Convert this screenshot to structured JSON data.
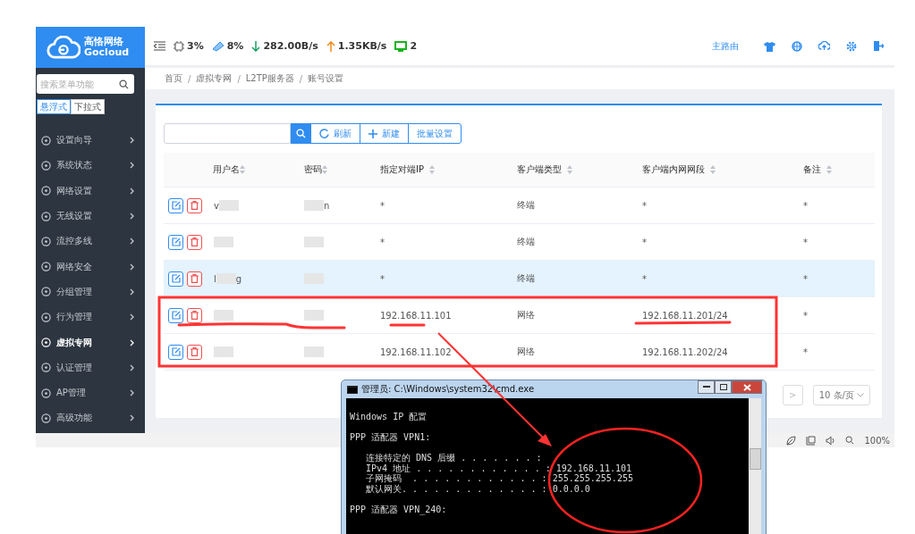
{
  "logo": {
    "name": "高恪网络",
    "brand": "Gocloud"
  },
  "stats": [
    {
      "kind": "cpu",
      "value": "3%"
    },
    {
      "kind": "memory",
      "value": "8%"
    },
    {
      "kind": "down",
      "value": "282.00B/s"
    },
    {
      "kind": "up",
      "value": "1.35KB/s"
    },
    {
      "kind": "devices",
      "value": "2"
    }
  ],
  "header_link": "主路由",
  "breadcrumb": [
    "首页",
    "虚拟专网",
    "L2TP服务器",
    "账号设置"
  ],
  "breadcrumb_separator": "/",
  "sidebar": {
    "search_placeholder": "搜索菜单功能",
    "modes": [
      {
        "label": "悬浮式",
        "selected": true
      },
      {
        "label": "下拉式",
        "selected": false
      }
    ],
    "items": [
      {
        "label": "设置向导",
        "selected": false
      },
      {
        "label": "系统状态",
        "selected": false
      },
      {
        "label": "网络设置",
        "selected": false
      },
      {
        "label": "无线设置",
        "selected": false
      },
      {
        "label": "流控多线",
        "selected": false
      },
      {
        "label": "网络安全",
        "selected": false
      },
      {
        "label": "分组管理",
        "selected": false
      },
      {
        "label": "行为管理",
        "selected": false
      },
      {
        "label": "虚拟专网",
        "selected": true
      },
      {
        "label": "认证管理",
        "selected": false
      },
      {
        "label": "AP管理",
        "selected": false
      },
      {
        "label": "高级功能",
        "selected": false
      }
    ]
  },
  "toolbar": {
    "refresh": "刷新",
    "create": "新建",
    "batch": "批量设置"
  },
  "table": {
    "columns": [
      "用户名",
      "密码",
      "指定对端IP",
      "客户端类型",
      "客户端内网网段",
      "备注"
    ],
    "rows": [
      {
        "selected": false,
        "user_prefix": "v",
        "pass_suffix": "n",
        "ip": "*",
        "type": "终端",
        "subnet": "*",
        "note": "*"
      },
      {
        "selected": false,
        "ip": "*",
        "type": "终端",
        "subnet": "*",
        "note": "*"
      },
      {
        "selected": true,
        "user_prefix": "l",
        "user_suffix": "g",
        "ip": "*",
        "type": "终端",
        "subnet": "*",
        "note": "*"
      },
      {
        "selected": false,
        "ip": "192.168.11.101",
        "type": "网络",
        "subnet": "192.168.11.201/24",
        "note": "*"
      },
      {
        "selected": false,
        "ip": "192.168.11.102",
        "type": "网络",
        "subnet": "192.168.11.202/24",
        "note": "*"
      }
    ]
  },
  "pagination": {
    "next": ">",
    "page_size": "10 条/页"
  },
  "browser_status": {
    "zoom": "100%"
  },
  "cmd": {
    "title": "管理员: C:\\Windows\\system32\\cmd.exe",
    "lines": [
      {
        "text": "Windows IP 配置",
        "gap": false
      },
      {
        "text": "PPP 适配器 VPN1:",
        "gap": true
      },
      {
        "text": "   连接特定的 DNS 后缀 . . . . . . . :",
        "gap": true
      },
      {
        "text": "   IPv4 地址 . . . . . . . . . . . . : 192.168.11.101",
        "gap": false
      },
      {
        "text": "   子网掩码  . . . . . . . . . . . . : 255.255.255.255",
        "gap": false
      },
      {
        "text": "   默认网关. . . . . . . . . . . . . : 0.0.0.0",
        "gap": false
      },
      {
        "text": "PPP 适配器 VPN_240:",
        "gap": true
      }
    ]
  }
}
